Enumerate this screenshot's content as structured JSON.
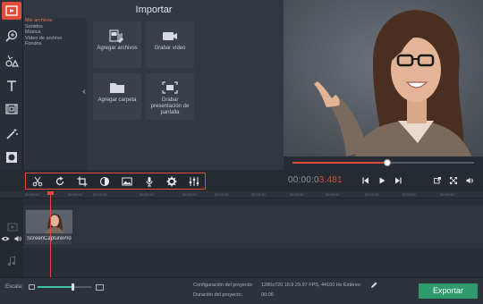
{
  "import": {
    "title": "Importar",
    "categories": [
      {
        "label": "Mis archivos",
        "selected": true
      },
      {
        "label": "Sonidos",
        "selected": false
      },
      {
        "label": "Música",
        "selected": false
      },
      {
        "label": "Vídeo de archivo",
        "selected": false
      },
      {
        "label": "Fondos",
        "selected": false
      }
    ],
    "collapse_glyph": "‹",
    "tiles": [
      {
        "label": "Agregar archivos",
        "icon": "add-files-icon"
      },
      {
        "label": "Grabar vídeo",
        "icon": "camera-icon"
      },
      {
        "label": "Agregar carpeta",
        "icon": "folder-icon"
      },
      {
        "label": "Grabar presentación de pantalla",
        "icon": "screen-capture-icon"
      }
    ]
  },
  "tools": [
    "import-icon",
    "zoom-icon",
    "shapes-icon",
    "text-icon",
    "film-icon",
    "magic-wand-icon",
    "overlay-icon"
  ],
  "edit_tools": [
    "scissors-icon",
    "redo-icon",
    "crop-icon",
    "color-icon",
    "image-icon",
    "microphone-icon",
    "gear-icon",
    "equalizer-icon"
  ],
  "player": {
    "time_dim": "00:00:0",
    "time_accent": "3.481",
    "progress": 0.52
  },
  "ruler_ticks": [
    "00:00:00",
    "00:00:05",
    "00:00:10",
    "00:00:15",
    "00:00:20",
    "00:00:25",
    "00:00:30",
    "00:00:35",
    "00:00:40",
    "00:00:45",
    "00:00:50",
    "00:00:55"
  ],
  "clip": {
    "name": "ScreenCapturePro"
  },
  "status": {
    "scale_label": "Escala:",
    "scale_value": 0.65,
    "config_label": "Configuración del proyecto:",
    "config_value": "1280x720 16:9 29.97 FPS, 44100 Hz Estéreo",
    "duration_label": "Duración del proyecto:",
    "duration_value": "00:06",
    "export_label": "Exportar"
  },
  "colors": {
    "accent": "#e04b3c",
    "export": "#2f9a6d",
    "scale": "#3ec4a3"
  }
}
